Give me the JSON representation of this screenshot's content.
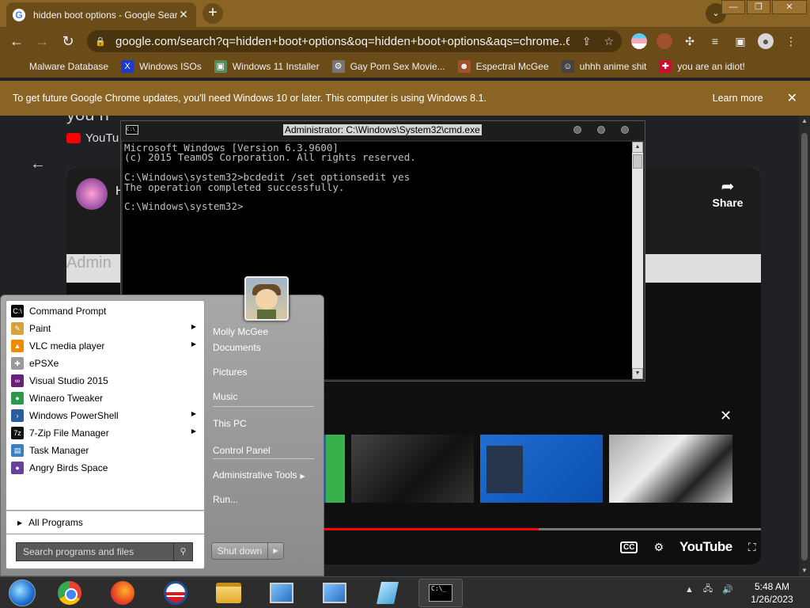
{
  "browser": {
    "tab": {
      "title": "hidden boot options - Google Sear",
      "close": "✕",
      "favicon": "G"
    },
    "new_tab": "+",
    "tab_search": "⌄",
    "window_controls": {
      "minimize": "—",
      "restore": "❐",
      "close": "✕"
    },
    "nav": {
      "back": "←",
      "forward": "→",
      "reload": "↻"
    },
    "url": "google.com/search?q=hidden+boot+options&oq=hidden+boot+options&aqs=chrome..69i5...",
    "bookmarks": [
      {
        "label": "Malware Database",
        "icon": "malware-icon",
        "glyph": "",
        "color": "#6b4c19"
      },
      {
        "label": "Windows ISOs",
        "icon": "x-logo-icon",
        "glyph": "X",
        "color": "#1a3cc9"
      },
      {
        "label": "Windows 11 Installer",
        "icon": "image-icon",
        "glyph": "▣",
        "color": "#5a8a5a"
      },
      {
        "label": "Gay Porn Sex Movie...",
        "icon": "gear-site-icon",
        "glyph": "⚙",
        "color": "#777777"
      },
      {
        "label": "Espectral McGee",
        "icon": "avatar-site-icon",
        "glyph": "☻",
        "color": "#a0522d"
      },
      {
        "label": "uhhh anime shit",
        "icon": "anime-site-icon",
        "glyph": "☺",
        "color": "#444444"
      },
      {
        "label": "you are an idiot!",
        "icon": "uk-flag-icon",
        "glyph": "✚",
        "color": "#c8102e"
      }
    ],
    "infobar": {
      "message": "To get future Google Chrome updates, you'll need Windows 10 or later. This computer is using Windows 8.1.",
      "learn_more": "Learn more",
      "close": "✕"
    }
  },
  "page": {
    "heading_fragment": "you n",
    "channel_label": "YouTu",
    "back": "←",
    "player": {
      "title_fragment": "H",
      "share": "Share",
      "share_arrow": "➦",
      "admin_fragment": "Admin",
      "close_suggestions": "✕",
      "progress_fraction": 0.68,
      "controls": {
        "cc": "CC",
        "settings": "⚙",
        "youtube": "YouTube",
        "fullscreen": "⛶"
      }
    }
  },
  "cmd": {
    "title": "Administrator: C:\\Windows\\System32\\cmd.exe",
    "icon_text": "C:\\_",
    "output": "Microsoft Windows [Version 6.3.9600]\n(c) 2015 TeamOS Corporation. All rights reserved.\n\nC:\\Windows\\system32>bcdedit /set optionsedit yes\nThe operation completed successfully.\n\nC:\\Windows\\system32>"
  },
  "start_menu": {
    "programs": [
      {
        "label": "Command Prompt",
        "icon": "cmd-icon",
        "color": "#000000",
        "glyph": "C:\\",
        "submenu": false
      },
      {
        "label": "Paint",
        "icon": "paint-icon",
        "color": "#d9a13a",
        "glyph": "✎",
        "submenu": true
      },
      {
        "label": "VLC media player",
        "icon": "vlc-icon",
        "color": "#f08a00",
        "glyph": "▲",
        "submenu": true
      },
      {
        "label": "ePSXe",
        "icon": "gamepad-icon",
        "color": "#9a9a9a",
        "glyph": "✚",
        "submenu": false
      },
      {
        "label": "Visual Studio 2015",
        "icon": "visual-studio-icon",
        "color": "#68217a",
        "glyph": "∞",
        "submenu": false
      },
      {
        "label": "Winaero Tweaker",
        "icon": "winaero-icon",
        "color": "#2a9a4a",
        "glyph": "●",
        "submenu": false
      },
      {
        "label": "Windows PowerShell",
        "icon": "powershell-icon",
        "color": "#2a5d9f",
        "glyph": "›",
        "submenu": true
      },
      {
        "label": "7-Zip File Manager",
        "icon": "7zip-icon",
        "color": "#111111",
        "glyph": "7z",
        "submenu": true
      },
      {
        "label": "Task Manager",
        "icon": "task-manager-icon",
        "color": "#3a7fbf",
        "glyph": "▤",
        "submenu": false
      },
      {
        "label": "Angry Birds Space",
        "icon": "angry-birds-icon",
        "color": "#6b3fa0",
        "glyph": "●",
        "submenu": false
      }
    ],
    "all_programs": "All Programs",
    "search_placeholder": "Search programs and files",
    "user": "Molly McGee",
    "links": [
      {
        "label": "Documents",
        "submenu": false
      },
      {
        "label": "Pictures",
        "submenu": false
      },
      {
        "label": "Music",
        "submenu": false
      },
      {
        "label": "This PC",
        "submenu": false
      },
      {
        "label": "Control Panel",
        "submenu": false
      },
      {
        "label": "Administrative Tools",
        "submenu": true
      },
      {
        "label": "Run...",
        "submenu": false
      }
    ],
    "shutdown": "Shut down"
  },
  "taskbar": {
    "clock_time": "5:48 AM",
    "clock_date": "1/26/2023",
    "tray": {
      "chevron": "▲",
      "network": "🖧",
      "volume": "🔊"
    }
  }
}
